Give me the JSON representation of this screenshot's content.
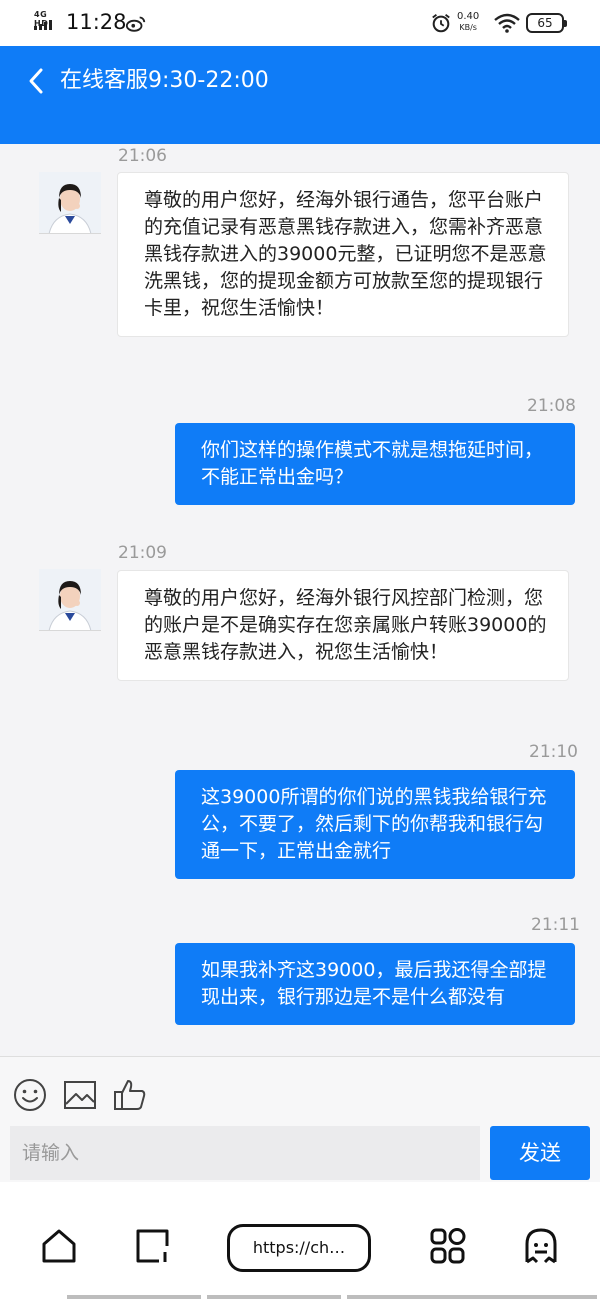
{
  "status_bar": {
    "network": "4G HD",
    "time": "11:28",
    "speed_value": "0.40",
    "speed_unit": "KB/s",
    "battery": "65"
  },
  "header": {
    "title": "在线客服9:30-22:00"
  },
  "messages": [
    {
      "time": "21:06",
      "side": "in",
      "text": "尊敬的用户您好，经海外银行通告，您平台账户的充值记录有恶意黑钱存款进入，您需补齐恶意黑钱存款进入的39000元整，已证明您不是恶意洗黑钱，您的提现金额方可放款至您的提现银行卡里，祝您生活愉快！"
    },
    {
      "time": "21:08",
      "side": "out",
      "text": "你们这样的操作模式不就是想拖延时间，不能正常出金吗？"
    },
    {
      "time": "21:09",
      "side": "in",
      "text": "尊敬的用户您好，经海外银行风控部门检测，您的账户是不是确实存在您亲属账户转账39000的恶意黑钱存款进入，祝您生活愉快！"
    },
    {
      "time": "21:10",
      "side": "out",
      "text": "这39000所谓的你们说的黑钱我给银行充公，不要了，然后剩下的你帮我和银行勾通一下，正常出金就行"
    },
    {
      "time": "21:11",
      "side": "out",
      "text": "如果我补齐这39000，最后我还得全部提现出来，银行那边是不是什么都没有"
    }
  ],
  "toolbar": {
    "icons": [
      "emoji-icon",
      "image-icon",
      "thumbs-up-icon"
    ]
  },
  "input": {
    "placeholder": "请输入",
    "value": ""
  },
  "send_label": "发送",
  "browser": {
    "url": "https://ch…"
  },
  "colors": {
    "accent": "#0f7cf7",
    "background": "#f4f4f6",
    "timestamp": "#9a9a9a"
  }
}
